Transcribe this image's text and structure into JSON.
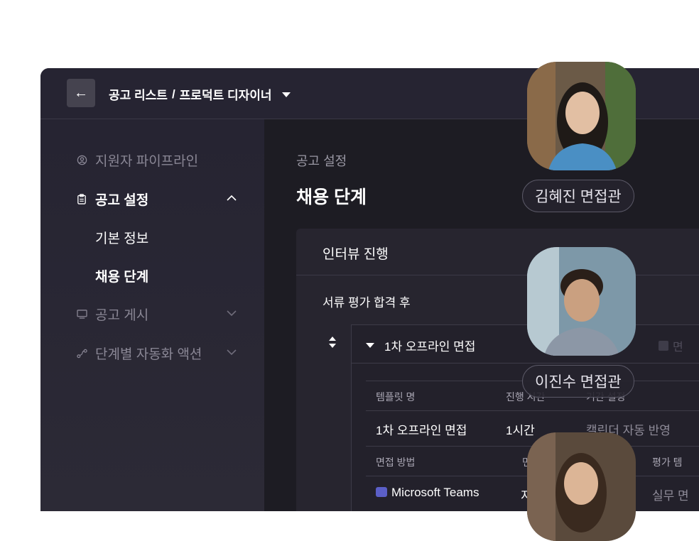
{
  "topbar": {
    "back_icon": "arrow-left-icon",
    "breadcrumb_list": "공고 리스트",
    "breadcrumb_sep": "/",
    "breadcrumb_current": "프로덕트 디자이너"
  },
  "sidebar": {
    "items": [
      {
        "label": "지원자 파이프라인",
        "icon": "user-circle-icon"
      },
      {
        "label": "공고 설정",
        "icon": "clipboard-icon"
      },
      {
        "label": "기본 정보"
      },
      {
        "label": "채용 단계"
      },
      {
        "label": "공고 게시",
        "icon": "monitor-icon"
      },
      {
        "label": "단계별 자동화 액션",
        "icon": "flow-icon"
      }
    ]
  },
  "content": {
    "breadcrumb": "공고 설정",
    "title": "채용 단계",
    "card_title": "인터뷰 진행",
    "stage_group_label": "서류 평가 합격 후",
    "stage": {
      "title": "1차 오프라인 면접",
      "extra": "면",
      "table": {
        "row1_headers": [
          "템플릿 명",
          "진행 시간",
          "기간 설정"
        ],
        "row1_values": [
          "1차 오프라인 면접",
          "1시간",
          "캘린더 자동 반영"
        ],
        "row2_headers": [
          "면접 방법",
          "면",
          "평가 템"
        ],
        "row2_values": [
          "Microsoft Teams",
          "지",
          "실무 면"
        ]
      }
    }
  },
  "interviewers": [
    {
      "name": "김혜진 면접관"
    },
    {
      "name": "이진수 면접관"
    }
  ],
  "colors": {
    "app_bg": "#1b1a21",
    "topbar_bg": "#262432",
    "accent_teams": "#5b5fc7"
  }
}
